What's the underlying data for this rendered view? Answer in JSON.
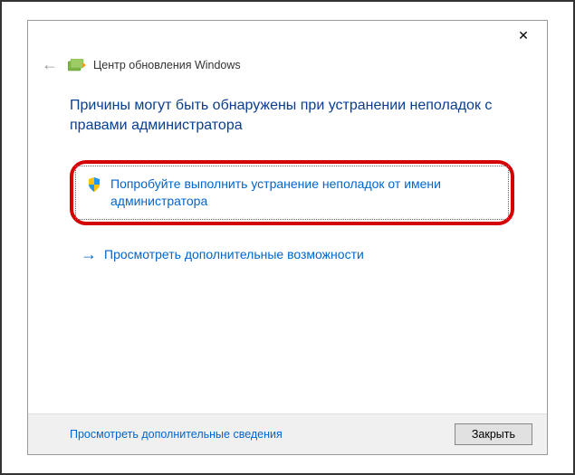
{
  "header": {
    "title": "Центр обновления Windows"
  },
  "content": {
    "heading": "Причины могут быть обнаружены при устранении неполадок с правами администратора",
    "admin_option": "Попробуйте выполнить устранение неполадок от имени администратора",
    "advanced_option": "Просмотреть дополнительные возможности"
  },
  "footer": {
    "details_link": "Просмотреть дополнительные сведения",
    "close_button": "Закрыть"
  },
  "icons": {
    "close": "✕",
    "back": "←",
    "arrow": "→"
  }
}
